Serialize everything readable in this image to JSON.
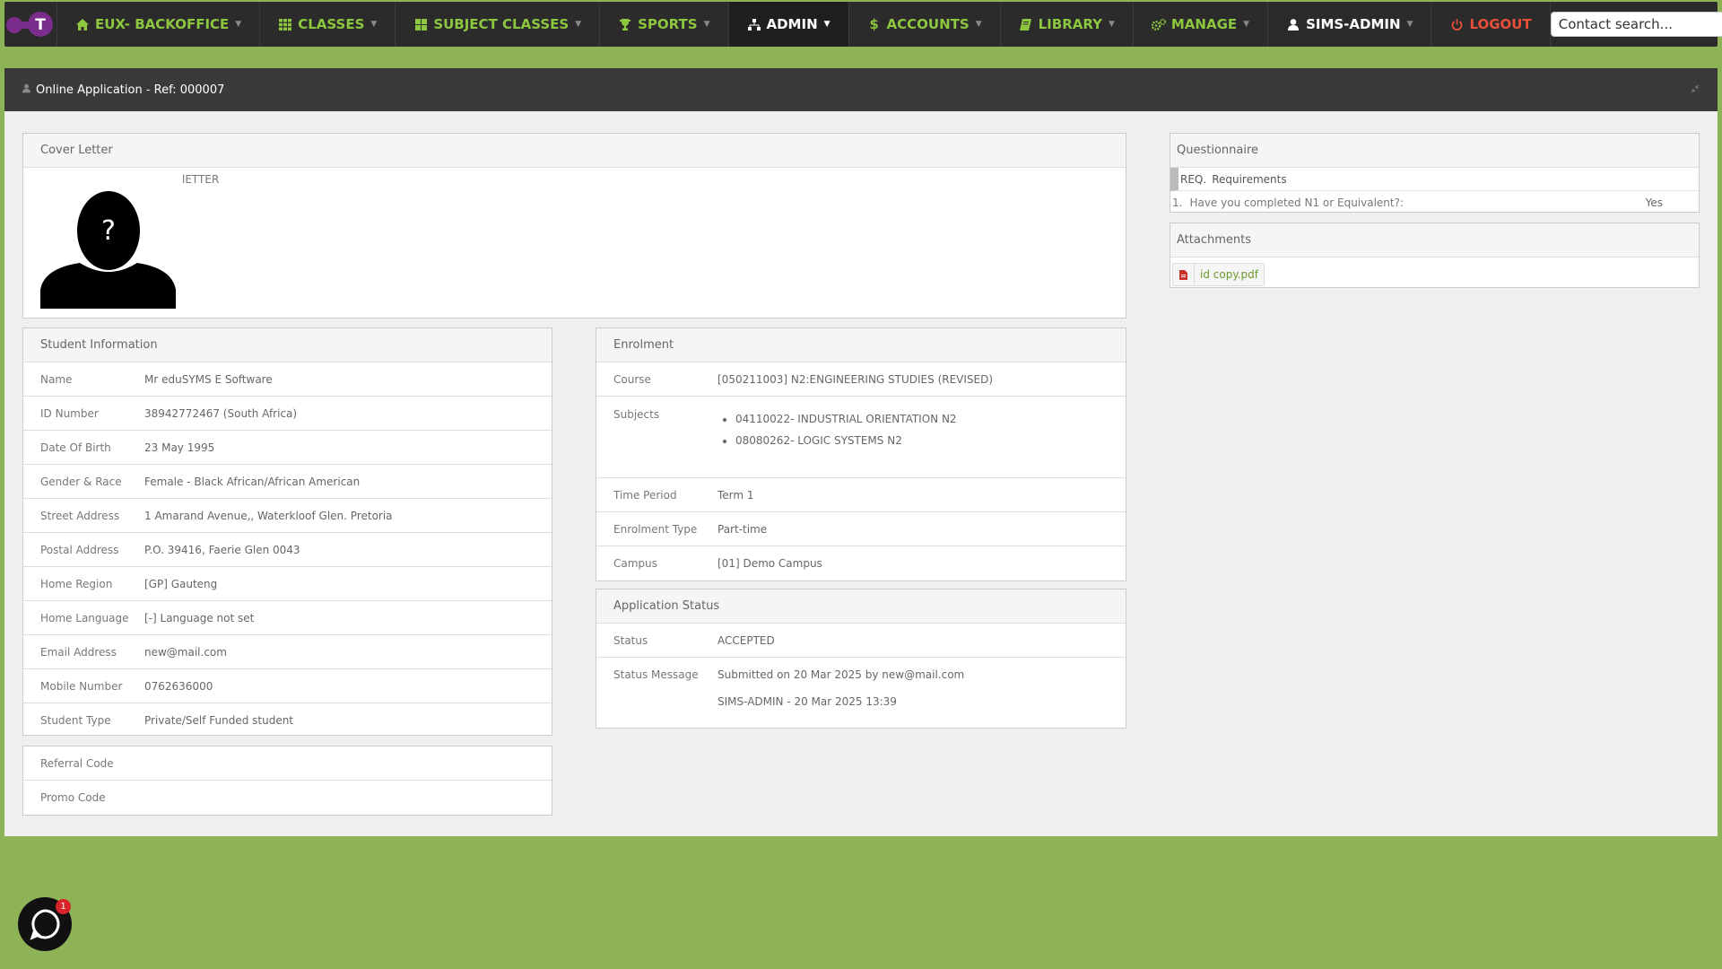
{
  "brand": {
    "letter": "T"
  },
  "navbar": {
    "items": [
      {
        "label": "EUX- BACKOFFICE",
        "icon": "home-icon"
      },
      {
        "label": "CLASSES",
        "icon": "grid-icon"
      },
      {
        "label": "SUBJECT CLASSES",
        "icon": "th-large-icon"
      },
      {
        "label": "SPORTS",
        "icon": "trophy-icon"
      },
      {
        "label": "ADMIN",
        "icon": "sitemap-icon"
      },
      {
        "label": "ACCOUNTS",
        "icon": "dollar-icon"
      },
      {
        "label": "LIBRARY",
        "icon": "book-icon"
      },
      {
        "label": "MANAGE",
        "icon": "gears-icon"
      },
      {
        "label": "SIMS-ADMIN",
        "icon": "user-icon"
      },
      {
        "label": "LOGOUT",
        "icon": "power-icon"
      }
    ],
    "search_placeholder": "Contact search..."
  },
  "page": {
    "title": "Online Application - Ref: 000007"
  },
  "cover_letter": {
    "heading": "Cover Letter",
    "text": "lETTER"
  },
  "student_info": {
    "heading": "Student Information",
    "rows": [
      {
        "label": "Name",
        "value": "Mr eduSYMS E Software"
      },
      {
        "label": "ID Number",
        "value": "38942772467 (South Africa)"
      },
      {
        "label": "Date Of Birth",
        "value": "23 May 1995"
      },
      {
        "label": "Gender & Race",
        "value": "Female - Black African/African American"
      },
      {
        "label": "Street Address",
        "value": "1 Amarand Avenue,, Waterkloof Glen. Pretoria"
      },
      {
        "label": "Postal Address",
        "value": "P.O. 39416, Faerie Glen 0043"
      },
      {
        "label": "Home Region",
        "value": "[GP] Gauteng"
      },
      {
        "label": "Home Language",
        "value": "[-] Language not set"
      },
      {
        "label": "Email Address",
        "value": "new@mail.com"
      },
      {
        "label": "Mobile Number",
        "value": "0762636000"
      },
      {
        "label": "Student Type",
        "value": "Private/Self Funded student"
      }
    ]
  },
  "codes": {
    "referral_label": "Referral Code",
    "promo_label": "Promo Code"
  },
  "enrolment": {
    "heading": "Enrolment",
    "course_label": "Course",
    "course_value": "[050211003] N2:ENGINEERING STUDIES (REVISED)",
    "subjects_label": "Subjects",
    "subjects": [
      "04110022- INDUSTRIAL ORIENTATION N2",
      "08080262- LOGIC SYSTEMS N2"
    ],
    "time_period_label": "Time Period",
    "time_period_value": "Term 1",
    "enrolment_type_label": "Enrolment Type",
    "enrolment_type_value": "Part-time",
    "campus_label": "Campus",
    "campus_value": "[01] Demo Campus"
  },
  "application_status": {
    "heading": "Application Status",
    "status_label": "Status",
    "status_value": "ACCEPTED",
    "message_label": "Status Message",
    "message_line1": "Submitted on 20 Mar 2025 by new@mail.com",
    "message_line2": "SIMS-ADMIN - 20 Mar 2025 13:39"
  },
  "questionnaire": {
    "heading": "Questionnaire",
    "section_code": "REQ.",
    "section_title": "Requirements",
    "items": [
      {
        "number": "1.",
        "question": "Have you completed N1 or Equivalent?:",
        "answer": "Yes"
      }
    ]
  },
  "attachments": {
    "heading": "Attachments",
    "files": [
      {
        "name": "id copy.pdf"
      }
    ]
  },
  "chat": {
    "badge_count": "1"
  },
  "colors": {
    "background": "#8db356",
    "navbar": "#2b2b2b",
    "nav_link": "#8dc63f",
    "logout": "#e8503a",
    "brand_purple": "#7b2d8e"
  }
}
